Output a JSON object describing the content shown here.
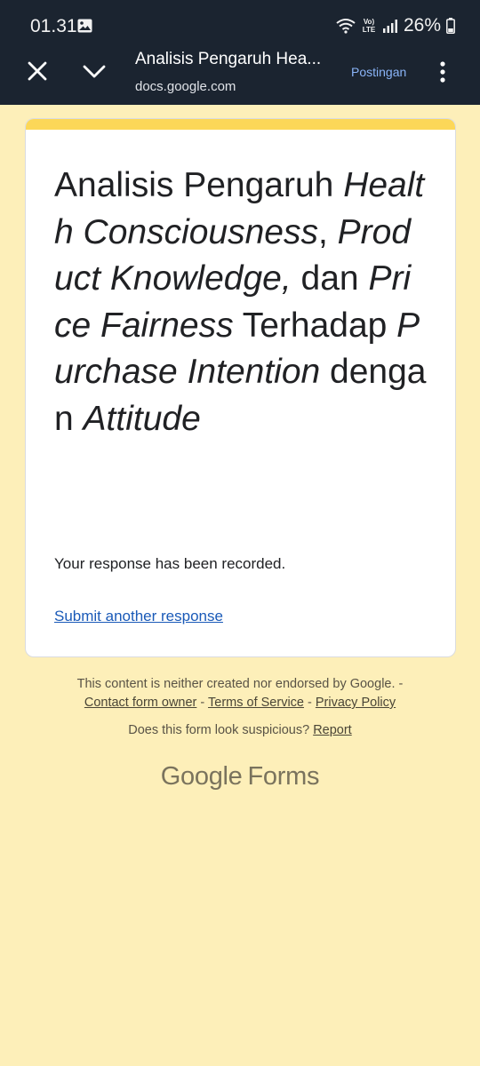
{
  "status_bar": {
    "time": "01.31",
    "network": "Vo) LTE",
    "battery": "26%"
  },
  "browser": {
    "title": "Analisis Pengaruh Hea...",
    "url": "docs.google.com",
    "action_label": "Postingan"
  },
  "form": {
    "title_parts": [
      {
        "text": "Analisis Pengaruh ",
        "italic": false
      },
      {
        "text": "Health Consciousness",
        "italic": true
      },
      {
        "text": ", ",
        "italic": false
      },
      {
        "text": "Product Knowledge,",
        "italic": true
      },
      {
        "text": " dan ",
        "italic": false
      },
      {
        "text": "Price Fairness",
        "italic": true
      },
      {
        "text": " Terhadap ",
        "italic": false
      },
      {
        "text": "Purchase Intention",
        "italic": true
      },
      {
        "text": " dengan ",
        "italic": false
      },
      {
        "text": "Attitude",
        "italic": true
      }
    ],
    "confirmation": "Your response has been recorded.",
    "another_link": "Submit another response"
  },
  "footer": {
    "disclaimer": "This content is neither created nor endorsed by Google. -",
    "contact": "Contact form owner",
    "sep1": " - ",
    "terms": "Terms of Service",
    "sep2": " - ",
    "privacy": "Privacy Policy",
    "suspicious": "Does this form look suspicious? ",
    "report": "Report"
  },
  "brand": {
    "google": "Google",
    "forms": "Forms"
  },
  "colors": {
    "page_bg": "#fdefb9",
    "accent": "#fcd758",
    "link": "#1a5ab8",
    "topbar": "#1b2430"
  }
}
